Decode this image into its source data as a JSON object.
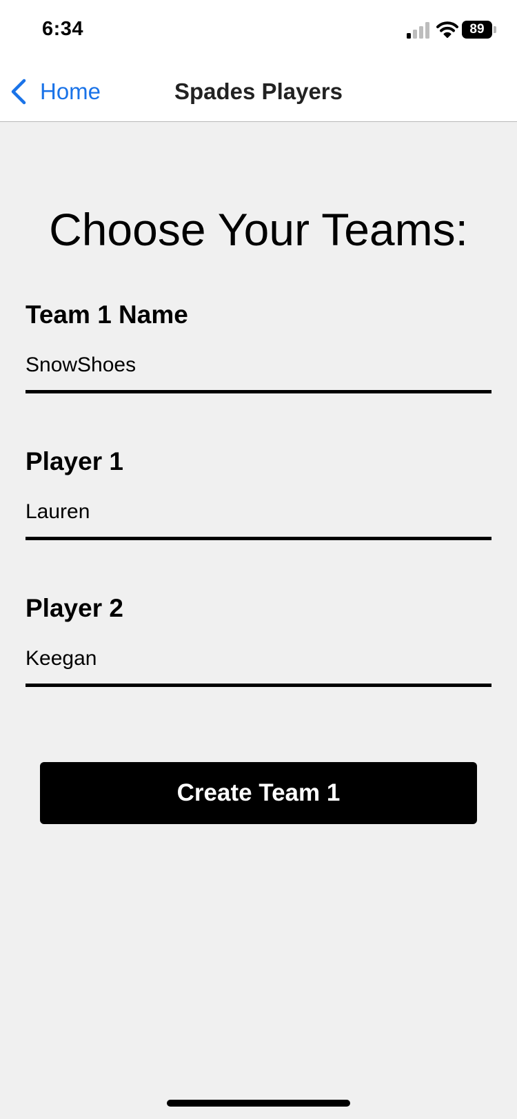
{
  "status_bar": {
    "time": "6:34",
    "battery_level": "89",
    "icons": [
      "signal-icon",
      "wifi-icon",
      "battery-icon"
    ]
  },
  "nav": {
    "back_label": "Home",
    "title": "Spades Players",
    "accent_color": "#1a73e8"
  },
  "main": {
    "heading": "Choose Your Teams:",
    "fields": [
      {
        "label": "Team 1 Name",
        "value": "SnowShoes"
      },
      {
        "label": "Player 1",
        "value": "Lauren"
      },
      {
        "label": "Player 2",
        "value": "Keegan"
      }
    ],
    "create_button_label": "Create Team 1"
  }
}
